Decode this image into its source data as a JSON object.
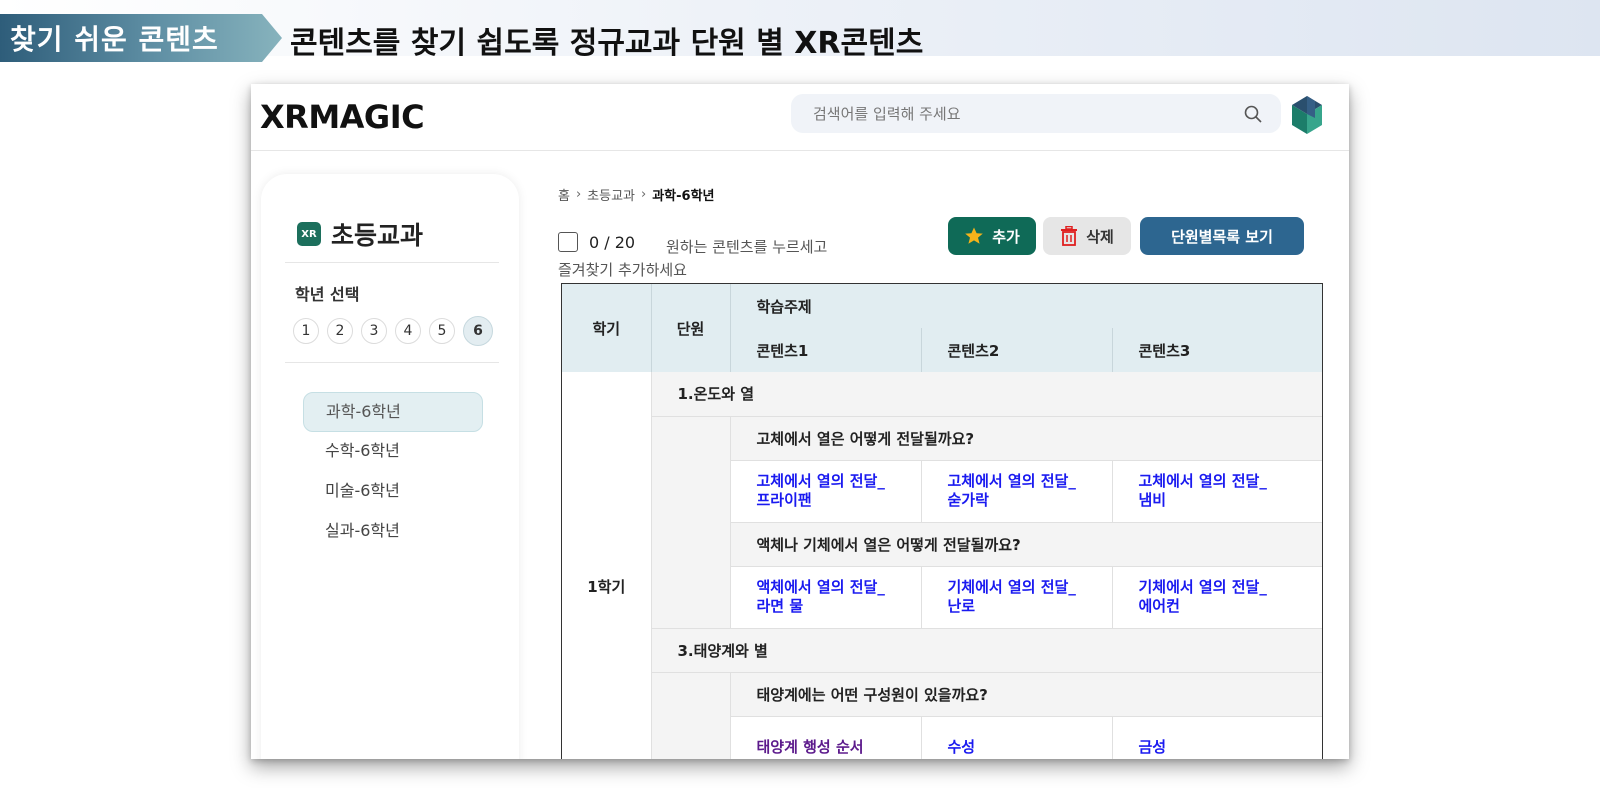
{
  "banner": {
    "tag": "찾기 쉬운 콘텐츠",
    "title": "콘텐츠를 찾기 쉽도록 정규교과 단원 별 XR콘텐츠"
  },
  "app": {
    "logo": "XRMAGIC",
    "search_placeholder": "검색어를 입력해 주세요"
  },
  "sidebar": {
    "badge": "XR",
    "title": "초등교과",
    "grade_label": "학년 선택",
    "grades": [
      "1",
      "2",
      "3",
      "4",
      "5",
      "6"
    ],
    "selected_grade": "6",
    "subjects": [
      "과학-6학년",
      "수학-6학년",
      "미술-6학년",
      "실과-6학년"
    ],
    "selected_subject": "과학-6학년"
  },
  "breadcrumb": [
    "홈",
    "초등교과",
    "과학-6학년"
  ],
  "selection": {
    "count": "0 / 20",
    "hint_line1": "원하는 콘텐츠를 누르세고",
    "hint_line2": "즐겨찾기 추가하세요"
  },
  "buttons": {
    "add": "추가",
    "delete": "삭제",
    "unit_list": "단원별목록 보기"
  },
  "table": {
    "headers": {
      "semester": "학기",
      "unit": "단원",
      "topic": "학습주제",
      "content1": "콘텐츠1",
      "content2": "콘텐츠2",
      "content3": "콘텐츠3"
    },
    "semester": "1학기",
    "units": [
      {
        "title": "1.온도와 열",
        "topics": [
          {
            "question": "고체에서 열은 어떻게 전달될까요?",
            "contents": [
              [
                "고체에서 열의 전달_",
                "프라이팬"
              ],
              [
                "고체에서 열의 전달_",
                "숟가락"
              ],
              [
                "고체에서 열의 전달_",
                "냄비"
              ]
            ]
          },
          {
            "question": "액체나 기체에서 열은 어떻게 전달될까요?",
            "contents": [
              [
                "액체에서 열의 전달_",
                "라면 물"
              ],
              [
                "기체에서 열의 전달_",
                "난로"
              ],
              [
                "기체에서 열의 전달_",
                "에어컨"
              ]
            ]
          }
        ]
      },
      {
        "title": "3.태양계와 별",
        "topics": [
          {
            "question": "태양계에는 어떤 구성원이 있을까요?",
            "contents": [
              [
                "태양계 행성 순서",
                ""
              ],
              [
                "수성",
                ""
              ],
              [
                "금성",
                ""
              ]
            ]
          }
        ]
      }
    ]
  },
  "colors": {
    "accent_green": "#0f6a57",
    "accent_blue": "#2d6690",
    "link": "#1a1af0",
    "visited_link": "#5c1a8c",
    "header_bg": "#e1edf1"
  }
}
